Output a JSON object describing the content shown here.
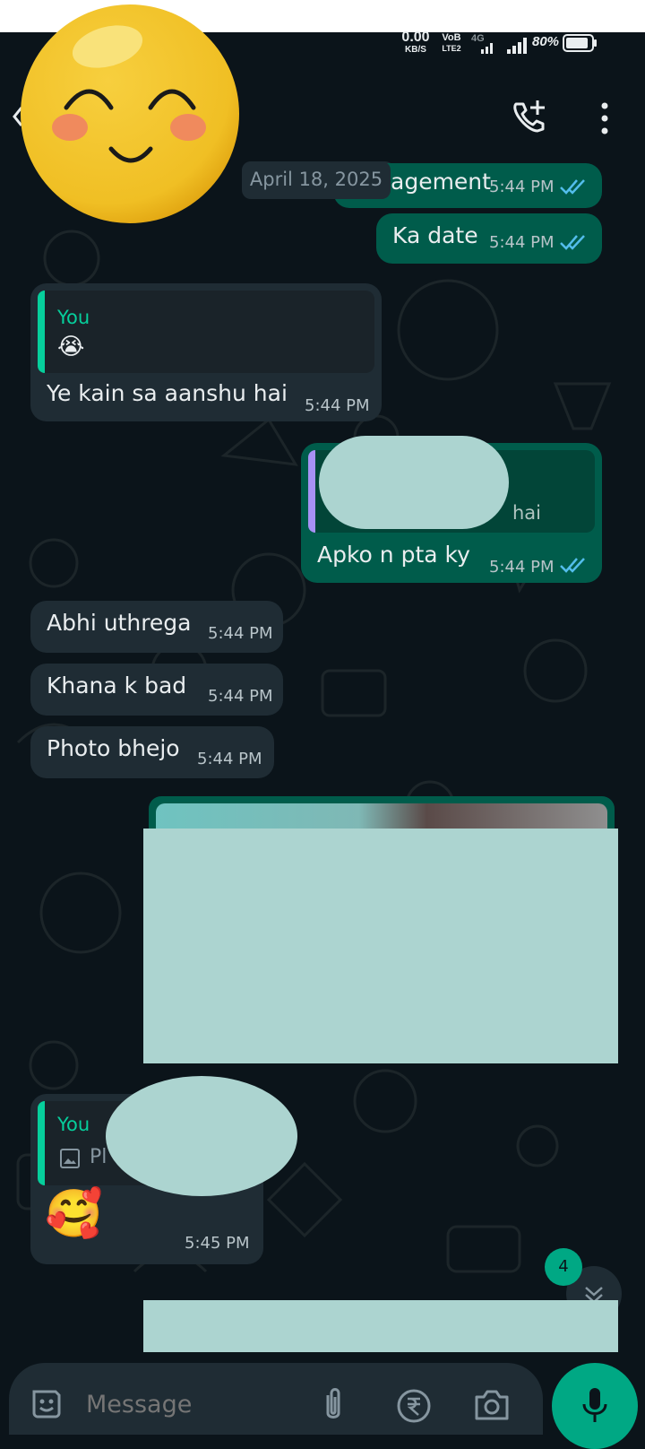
{
  "status_bar": {
    "speed_value": "0.00",
    "speed_unit": "KB/S",
    "volte": "VoB",
    "volte_sub": "LTE2",
    "network": "4G",
    "battery_percent": "80%"
  },
  "chat": {
    "date_label": "April 18, 2025",
    "messages": [
      {
        "type": "outgoing",
        "text": "agement",
        "time": "5:44 PM"
      },
      {
        "type": "outgoing",
        "text": "Ka date",
        "time": "5:44 PM"
      },
      {
        "type": "incoming",
        "quote_author": "You",
        "quote_emoji": "😭",
        "text": "Ye kain sa aanshu hai",
        "time": "5:44 PM"
      },
      {
        "type": "outgoing",
        "quote_partial": "hai",
        "text": "Apko n pta ky",
        "time": "5:44 PM"
      },
      {
        "type": "incoming",
        "text": "Abhi uthrega",
        "time": "5:44 PM"
      },
      {
        "type": "incoming",
        "text": "Khana k bad",
        "time": "5:44 PM"
      },
      {
        "type": "incoming",
        "text": "Photo bhejo",
        "time": "5:44 PM"
      },
      {
        "type": "incoming",
        "quote_author": "You",
        "quote_partial": "Pl",
        "emoji": "🥰",
        "time": "5:45 PM"
      }
    ],
    "unread_count": "4"
  },
  "composer": {
    "placeholder": "Message"
  },
  "icons": {
    "add_call": "add-call-icon",
    "menu": "more-vert-icon",
    "sticker": "sticker-icon",
    "attach": "paperclip-icon",
    "payment": "rupee-icon",
    "camera": "camera-icon",
    "mic": "mic-icon",
    "scroll_down": "chevron-down-icon"
  },
  "colors": {
    "background": "#0b141a",
    "incoming_bubble": "#1f2c34",
    "outgoing_bubble": "#005c4b",
    "accent_green": "#00a884",
    "read_tick": "#53bdeb",
    "quote_green": "#06cf9c",
    "quote_purple": "#a791f5"
  }
}
